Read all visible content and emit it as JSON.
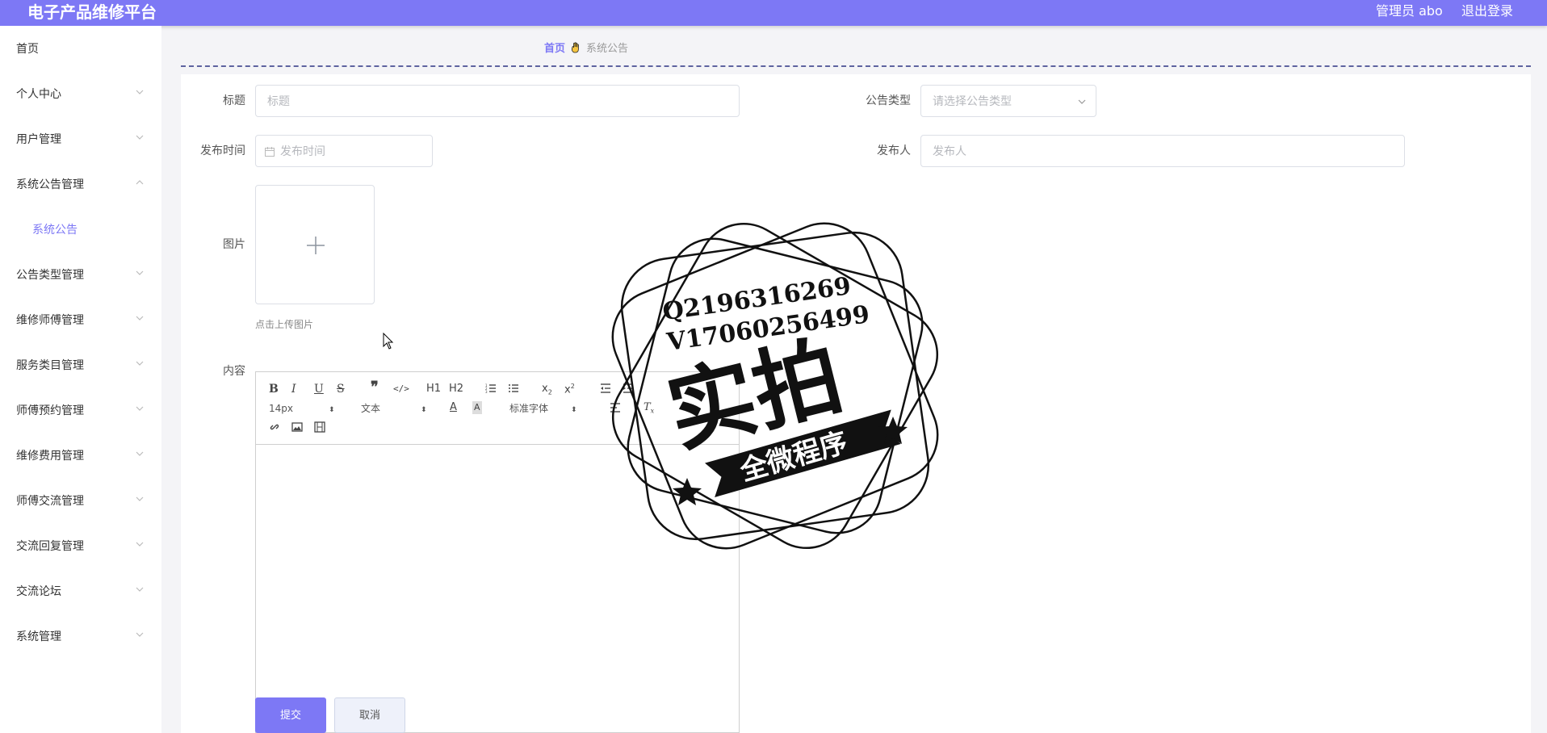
{
  "header": {
    "title": "电子产品维修平台",
    "user": "管理员 abo",
    "logout": "退出登录"
  },
  "sidebar": {
    "items": [
      {
        "label": "首页"
      },
      {
        "label": "个人中心"
      },
      {
        "label": "用户管理"
      },
      {
        "label": "系统公告管理"
      },
      {
        "label": "系统公告"
      },
      {
        "label": "公告类型管理"
      },
      {
        "label": "维修师傅管理"
      },
      {
        "label": "服务类目管理"
      },
      {
        "label": "师傅预约管理"
      },
      {
        "label": "维修费用管理"
      },
      {
        "label": "师傅交流管理"
      },
      {
        "label": "交流回复管理"
      },
      {
        "label": "交流论坛"
      },
      {
        "label": "系统管理"
      }
    ]
  },
  "breadcrumb": {
    "home": "首页",
    "current": "系统公告"
  },
  "form": {
    "title_label": "标题",
    "title_placeholder": "标题",
    "type_label": "公告类型",
    "type_placeholder": "请选择公告类型",
    "time_label": "发布时间",
    "time_placeholder": "发布时间",
    "publisher_label": "发布人",
    "publisher_placeholder": "发布人",
    "image_label": "图片",
    "upload_hint": "点击上传图片",
    "content_label": "内容"
  },
  "editor": {
    "font_size": "14px",
    "header_select": "文本",
    "font_family": "标准字体",
    "h1": "H1",
    "h2": "H2"
  },
  "buttons": {
    "submit": "提交",
    "cancel": "取消"
  },
  "watermark": {
    "line1": "Q2196316269",
    "line2": "V17060256499",
    "main": "实拍",
    "banner": "全微程序"
  },
  "colors": {
    "accent": "#7d78f5"
  }
}
